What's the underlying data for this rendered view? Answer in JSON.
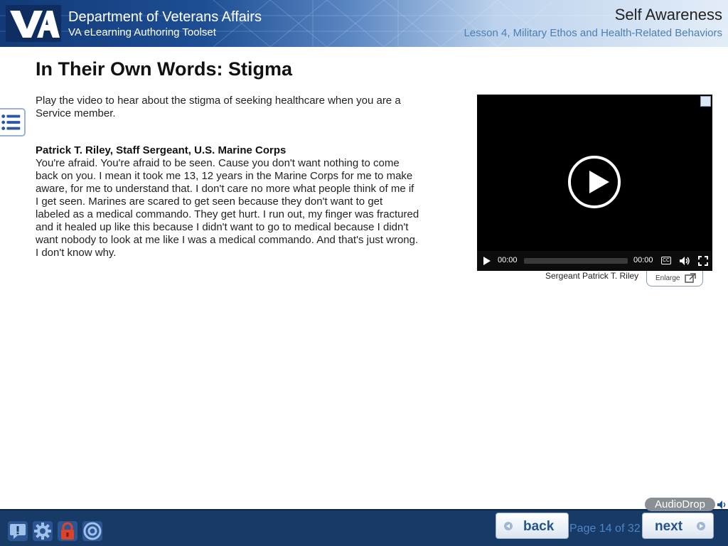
{
  "header": {
    "org_title": "Department of Veterans Affairs",
    "org_subtitle": "VA eLearning Authoring Toolset",
    "course_title": "Self Awareness",
    "lesson_title": "Lesson 4, Military Ethos and Health-Related Behaviors",
    "logo_text": "VA",
    "logo_icon": "va-logo"
  },
  "main": {
    "page_title": "In Their Own Words: Stigma",
    "intro": "Play the video to hear about the stigma of seeking healthcare when you are a Service member.",
    "speaker": "Patrick T. Riley, Staff Sergeant, U.S. Marine Corps",
    "quote": "You're afraid. You're afraid to be seen. Cause you don't want nothing to come back on you. I mean it took me 13, 12 years in the Marine Corps for me to make aware, for me to understand that. I don't care no more what people think of me if I get seen. Marines are scared to get seen because they don't want to get labeled as a medical commando. They get hurt. I run out, my finger was fractured and it healed up like this because I didn't want to go to medical because I didn't want nobody to look at me like I was a medical commando. And that's just wrong. I don't know why."
  },
  "sidebar": {
    "menu_icon": "list-icon"
  },
  "video": {
    "current_time": "00:00",
    "duration": "00:00",
    "cc_label": "CC",
    "progress": 0,
    "caption": "Sergeant Patrick T. Riley",
    "enlarge_label": "Enlarge"
  },
  "footer": {
    "icons": [
      "help-icon",
      "settings-icon",
      "lock-icon",
      "target-icon"
    ],
    "audiodrop_label": "AudioDrop",
    "back_label": "back",
    "next_label": "next",
    "page_indicator": "Page 14 of 32"
  },
  "colors": {
    "header_dark": "#123a78",
    "footer_bg": "#173a66",
    "lesson_link": "#4a7fb6",
    "page_indicator": "#4f86c3"
  }
}
